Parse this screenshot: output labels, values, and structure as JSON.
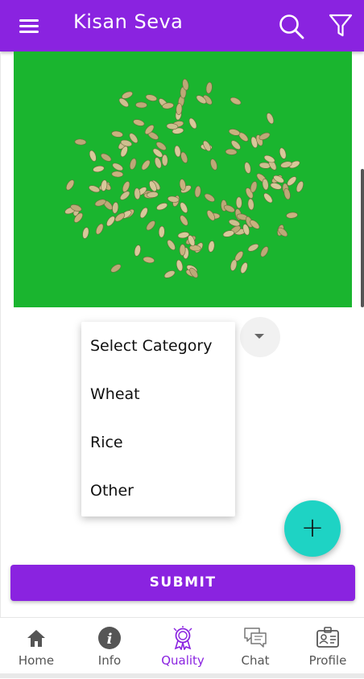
{
  "appbar": {
    "title": "Kisan Seva",
    "menu_icon": "hamburger-menu-icon",
    "search_icon": "search-icon",
    "filter_icon": "filter-icon",
    "color": "#8a23e0"
  },
  "photo": {
    "subject": "grain-sample-photo",
    "background": "#1ab52f"
  },
  "category_dropdown": {
    "options": [
      "Select Category",
      "Wheat",
      "Rice",
      "Other"
    ]
  },
  "fab": {
    "label": "+",
    "color": "#1ed3c4"
  },
  "submit": {
    "label": "SUBMIT"
  },
  "bottom_nav": {
    "items": [
      {
        "label": "Home",
        "icon": "home-icon"
      },
      {
        "label": "Info",
        "icon": "info-icon"
      },
      {
        "label": "Quality",
        "icon": "quality-badge-icon",
        "active": true
      },
      {
        "label": "Chat",
        "icon": "chat-icon"
      },
      {
        "label": "Profile",
        "icon": "profile-card-icon"
      }
    ]
  }
}
